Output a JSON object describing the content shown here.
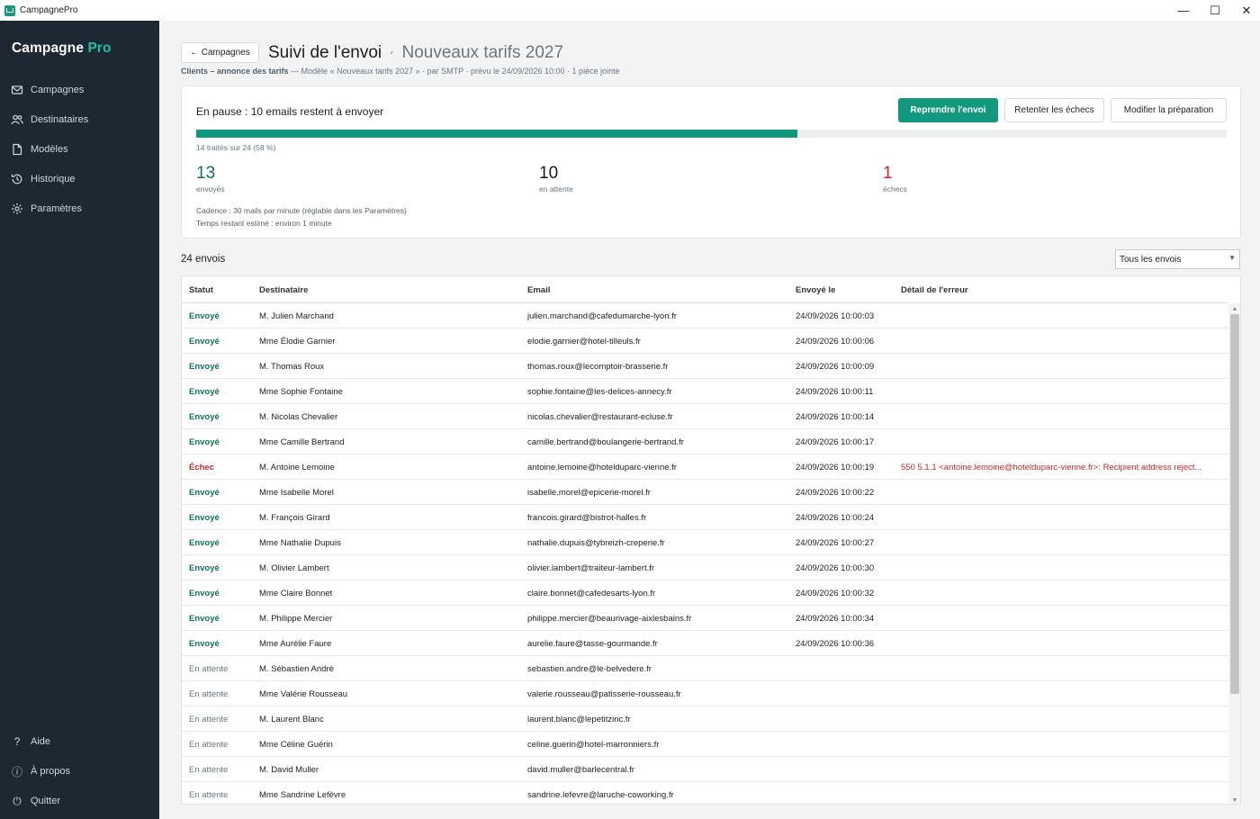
{
  "window": {
    "title": "CampagnePro",
    "minimize_glyph": "—",
    "maximize_glyph": "☐",
    "close_glyph": "✕"
  },
  "sidebar": {
    "brand_main": "Campagne",
    "brand_accent": "Pro",
    "items": [
      {
        "label": "Campagnes",
        "icon": "mail-icon"
      },
      {
        "label": "Destinataires",
        "icon": "users-icon"
      },
      {
        "label": "Modèles",
        "icon": "document-icon"
      },
      {
        "label": "Historique",
        "icon": "history-icon"
      },
      {
        "label": "Paramètres",
        "icon": "gear-icon"
      }
    ],
    "bottom_items": [
      {
        "label": "Aide",
        "icon": "help-icon",
        "glyph": "?"
      },
      {
        "label": "À propos",
        "icon": "info-icon",
        "glyph": "ⓘ"
      },
      {
        "label": "Quitter",
        "icon": "power-icon",
        "glyph": "⏻"
      }
    ]
  },
  "header": {
    "back_label": "← Campagnes",
    "title": "Suivi de l'envoi",
    "title_sep": "·",
    "campaign_name": "Nouveaux tarifs 2027",
    "meta_client": "Clients – annonce des tarifs",
    "meta_rest": " — Modèle « Nouveaux tarifs 2027 » · par SMTP · prévu le 24/09/2026 10:00 · 1 pièce jointe"
  },
  "progress_card": {
    "status_text": "En pause : 10 emails restent à envoyer",
    "resume_label": "Reprendre l'envoi",
    "retry_label": "Retenter les échecs",
    "edit_label": "Modifier la préparation",
    "progress_fraction": 0.583,
    "progress_label": "14 traités sur 24 (58 %)",
    "sent_count": "13",
    "sent_label": "envoyés",
    "pending_count": "10",
    "pending_label": "en attente",
    "failed_count": "1",
    "failed_label": "échecs",
    "cadence": "Cadence : 30 mails par minute (réglable dans les Paramètres)",
    "remaining": "Temps restant estimé : environ 1 minute"
  },
  "table": {
    "count_label": "24 envois",
    "filter_value": "Tous les envois",
    "columns": [
      "Statut",
      "Destinataire",
      "Email",
      "Envoyé le",
      "Détail de l'erreur"
    ],
    "rows": [
      {
        "status": "Envoyé",
        "kind": "sent",
        "name": "M. Julien Marchand",
        "email": "julien.marchand@cafedumarche-lyon.fr",
        "date": "24/09/2026 10:00:03",
        "error": ""
      },
      {
        "status": "Envoyé",
        "kind": "sent",
        "name": "Mme Élodie Garnier",
        "email": "elodie.garnier@hotel-tilleuls.fr",
        "date": "24/09/2026 10:00:06",
        "error": ""
      },
      {
        "status": "Envoyé",
        "kind": "sent",
        "name": "M. Thomas Roux",
        "email": "thomas.roux@lecomptoir-brasserie.fr",
        "date": "24/09/2026 10:00:09",
        "error": ""
      },
      {
        "status": "Envoyé",
        "kind": "sent",
        "name": "Mme Sophie Fontaine",
        "email": "sophie.fontaine@les-delices-annecy.fr",
        "date": "24/09/2026 10:00:11",
        "error": ""
      },
      {
        "status": "Envoyé",
        "kind": "sent",
        "name": "M. Nicolas Chevalier",
        "email": "nicolas.chevalier@restaurant-ecluse.fr",
        "date": "24/09/2026 10:00:14",
        "error": ""
      },
      {
        "status": "Envoyé",
        "kind": "sent",
        "name": "Mme Camille Bertrand",
        "email": "camille.bertrand@boulangerie-bertrand.fr",
        "date": "24/09/2026 10:00:17",
        "error": ""
      },
      {
        "status": "Échec",
        "kind": "failed",
        "name": "M. Antoine Lemoine",
        "email": "antoine.lemoine@hotelduparc-vienne.fr",
        "date": "24/09/2026 10:00:19",
        "error": "550 5.1.1 <antoine.lemoine@hotelduparc-vienne.fr>: Recipient address reject..."
      },
      {
        "status": "Envoyé",
        "kind": "sent",
        "name": "Mme Isabelle Morel",
        "email": "isabelle.morel@epicerie-morel.fr",
        "date": "24/09/2026 10:00:22",
        "error": ""
      },
      {
        "status": "Envoyé",
        "kind": "sent",
        "name": "M. François Girard",
        "email": "francois.girard@bistrot-halles.fr",
        "date": "24/09/2026 10:00:24",
        "error": ""
      },
      {
        "status": "Envoyé",
        "kind": "sent",
        "name": "Mme Nathalie Dupuis",
        "email": "nathalie.dupuis@tybreizh-creperie.fr",
        "date": "24/09/2026 10:00:27",
        "error": ""
      },
      {
        "status": "Envoyé",
        "kind": "sent",
        "name": "M. Olivier Lambert",
        "email": "olivier.lambert@traiteur-lambert.fr",
        "date": "24/09/2026 10:00:30",
        "error": ""
      },
      {
        "status": "Envoyé",
        "kind": "sent",
        "name": "Mme Claire Bonnet",
        "email": "claire.bonnet@cafedesarts-lyon.fr",
        "date": "24/09/2026 10:00:32",
        "error": ""
      },
      {
        "status": "Envoyé",
        "kind": "sent",
        "name": "M. Philippe Mercier",
        "email": "philippe.mercier@beaurivage-aixlesbains.fr",
        "date": "24/09/2026 10:00:34",
        "error": ""
      },
      {
        "status": "Envoyé",
        "kind": "sent",
        "name": "Mme Aurélie Faure",
        "email": "aurelie.faure@tasse-gourmande.fr",
        "date": "24/09/2026 10:00:36",
        "error": ""
      },
      {
        "status": "En attente",
        "kind": "pending",
        "name": "M. Sébastien André",
        "email": "sebastien.andre@le-belvedere.fr",
        "date": "",
        "error": ""
      },
      {
        "status": "En attente",
        "kind": "pending",
        "name": "Mme Valérie Rousseau",
        "email": "valerie.rousseau@patisserie-rousseau.fr",
        "date": "",
        "error": ""
      },
      {
        "status": "En attente",
        "kind": "pending",
        "name": "M. Laurent Blanc",
        "email": "laurent.blanc@lepetitzinc.fr",
        "date": "",
        "error": ""
      },
      {
        "status": "En attente",
        "kind": "pending",
        "name": "Mme Céline Guérin",
        "email": "celine.guerin@hotel-marronniers.fr",
        "date": "",
        "error": ""
      },
      {
        "status": "En attente",
        "kind": "pending",
        "name": "M. David Muller",
        "email": "david.muller@barlecentral.fr",
        "date": "",
        "error": ""
      },
      {
        "status": "En attente",
        "kind": "pending",
        "name": "Mme Sandrine Lefèvre",
        "email": "sandrine.lefevre@laruche-coworking.fr",
        "date": "",
        "error": ""
      }
    ]
  }
}
